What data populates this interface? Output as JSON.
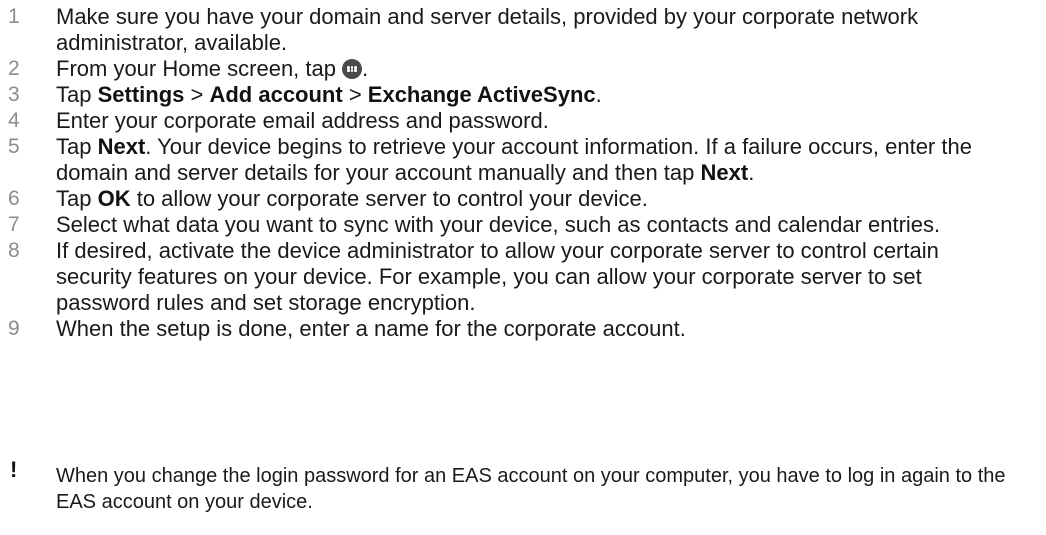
{
  "steps": [
    {
      "num": "1",
      "parts": [
        {
          "t": "Make sure you have your domain and server details, provided by your corporate network administrator, available."
        }
      ]
    },
    {
      "num": "2",
      "parts": [
        {
          "t": "From your Home screen, tap "
        },
        {
          "icon": "apps-icon"
        },
        {
          "t": "."
        }
      ]
    },
    {
      "num": "3",
      "parts": [
        {
          "t": "Tap "
        },
        {
          "b": "Settings"
        },
        {
          "t": " > "
        },
        {
          "b": "Add account"
        },
        {
          "t": " > "
        },
        {
          "b": "Exchange ActiveSync"
        },
        {
          "t": "."
        }
      ]
    },
    {
      "num": "4",
      "parts": [
        {
          "t": "Enter your corporate email address and password."
        }
      ]
    },
    {
      "num": "5",
      "parts": [
        {
          "t": "Tap "
        },
        {
          "b": "Next"
        },
        {
          "t": ". Your device begins to retrieve your account information. If a failure occurs, enter the domain and server details for your account manually and then tap "
        },
        {
          "b": "Next"
        },
        {
          "t": "."
        }
      ]
    },
    {
      "num": "6",
      "parts": [
        {
          "t": "Tap "
        },
        {
          "b": "OK"
        },
        {
          "t": " to allow your corporate server to control your device."
        }
      ]
    },
    {
      "num": "7",
      "parts": [
        {
          "t": "Select what data you want to sync with your device, such as contacts and calendar entries."
        }
      ]
    },
    {
      "num": "8",
      "parts": [
        {
          "t": "If desired, activate the device administrator to allow your corporate server to control certain security features on your device. For example, you can allow your corporate server to set password rules and set storage encryption."
        }
      ]
    },
    {
      "num": "9",
      "parts": [
        {
          "t": "When the setup is done, enter a name for the corporate account."
        }
      ]
    }
  ],
  "note": {
    "icon": "exclamation-icon",
    "symbol": "!",
    "text": "When you change the login password for an EAS account on your computer, you have to log in again to the EAS account on your device."
  }
}
